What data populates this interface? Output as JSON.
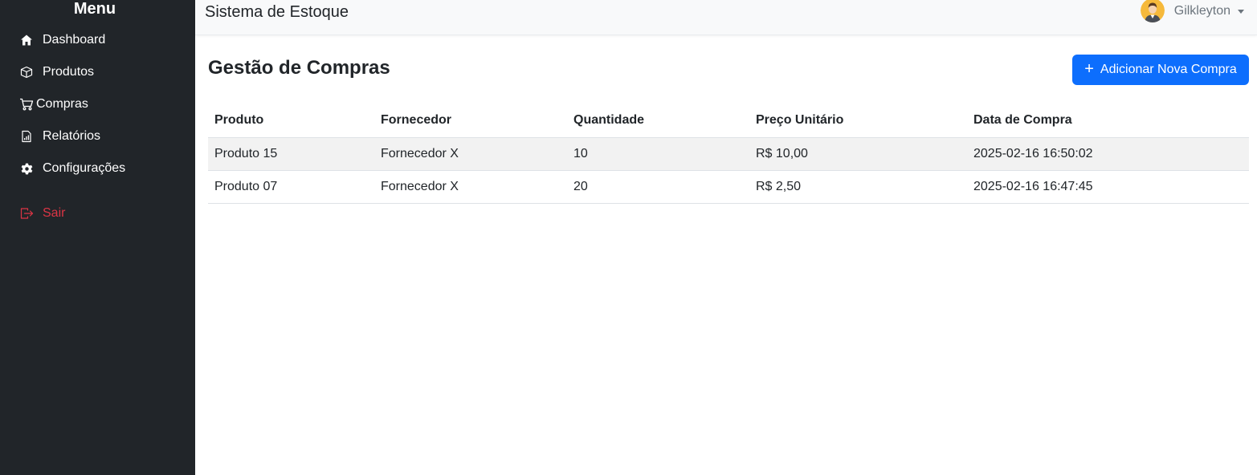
{
  "sidebar": {
    "title": "Menu",
    "items": [
      {
        "label": "Dashboard",
        "icon": "house-icon"
      },
      {
        "label": "Produtos",
        "icon": "box-icon"
      },
      {
        "label": "Compras",
        "icon": "cart-icon"
      },
      {
        "label": "Relatórios",
        "icon": "report-icon"
      },
      {
        "label": "Configurações",
        "icon": "gear-icon"
      }
    ],
    "logout": {
      "label": "Sair",
      "icon": "logout-icon"
    }
  },
  "topbar": {
    "brand": "Sistema de Estoque",
    "user_name": "Gilkleyton"
  },
  "main": {
    "title": "Gestão de Compras",
    "add_button": "Adicionar Nova Compra",
    "table": {
      "headers": [
        "Produto",
        "Fornecedor",
        "Quantidade",
        "Preço Unitário",
        "Data de Compra"
      ],
      "rows": [
        [
          "Produto 15",
          "Fornecedor X",
          "10",
          "R$ 10,00",
          "2025-02-16 16:50:02"
        ],
        [
          "Produto 07",
          "Fornecedor X",
          "20",
          "R$ 2,50",
          "2025-02-16 16:47:45"
        ]
      ]
    }
  },
  "colors": {
    "sidebar_bg": "#212529",
    "primary": "#0d6efd",
    "danger": "#dc3545",
    "navbar_bg": "#f8f9fa"
  }
}
